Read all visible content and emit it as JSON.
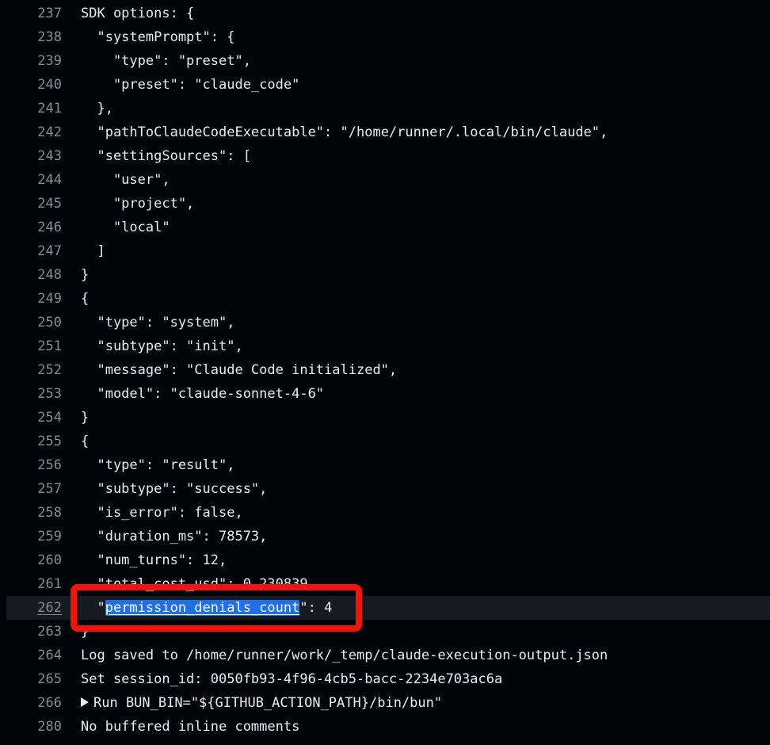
{
  "log": {
    "lines": [
      {
        "n": "237",
        "text": "SDK options: {"
      },
      {
        "n": "238",
        "text": "  \"systemPrompt\": {"
      },
      {
        "n": "239",
        "text": "    \"type\": \"preset\","
      },
      {
        "n": "240",
        "text": "    \"preset\": \"claude_code\""
      },
      {
        "n": "241",
        "text": "  },"
      },
      {
        "n": "242",
        "text": "  \"pathToClaudeCodeExecutable\": \"/home/runner/.local/bin/claude\","
      },
      {
        "n": "243",
        "text": "  \"settingSources\": ["
      },
      {
        "n": "244",
        "text": "    \"user\","
      },
      {
        "n": "245",
        "text": "    \"project\","
      },
      {
        "n": "246",
        "text": "    \"local\""
      },
      {
        "n": "247",
        "text": "  ]"
      },
      {
        "n": "248",
        "text": "}"
      },
      {
        "n": "249",
        "text": "{"
      },
      {
        "n": "250",
        "text": "  \"type\": \"system\","
      },
      {
        "n": "251",
        "text": "  \"subtype\": \"init\","
      },
      {
        "n": "252",
        "text": "  \"message\": \"Claude Code initialized\","
      },
      {
        "n": "253",
        "text": "  \"model\": \"claude-sonnet-4-6\""
      },
      {
        "n": "254",
        "text": "}"
      },
      {
        "n": "255",
        "text": "{"
      },
      {
        "n": "256",
        "text": "  \"type\": \"result\","
      },
      {
        "n": "257",
        "text": "  \"subtype\": \"success\","
      },
      {
        "n": "258",
        "text": "  \"is_error\": false,"
      },
      {
        "n": "259",
        "text": "  \"duration_ms\": 78573,"
      },
      {
        "n": "260",
        "text": "  \"num_turns\": 12,"
      },
      {
        "n": "261",
        "text": "  \"total_cost_usd\": 0.230839,"
      },
      {
        "n": "262",
        "pre": "  \"",
        "sel": "permission_denials_count",
        "post": "\": 4"
      },
      {
        "n": "263",
        "text": "}"
      },
      {
        "n": "264",
        "text": "Log saved to /home/runner/work/_temp/claude-execution-output.json"
      },
      {
        "n": "265",
        "text": "Set session_id: 0050fb93-4f96-4cb5-bacc-2234e703ac6a"
      },
      {
        "n": "266",
        "text": "Run BUN_BIN=\"${GITHUB_ACTION_PATH}/bin/bun\""
      },
      {
        "n": "280",
        "text": "No buffered inline comments"
      }
    ]
  },
  "colors": {
    "background": "#010409",
    "highlight_row": "#161b22",
    "selection": "#1f6feb",
    "callout_border": "#f0140c"
  },
  "icons": {
    "expand": "caret-right-icon"
  }
}
